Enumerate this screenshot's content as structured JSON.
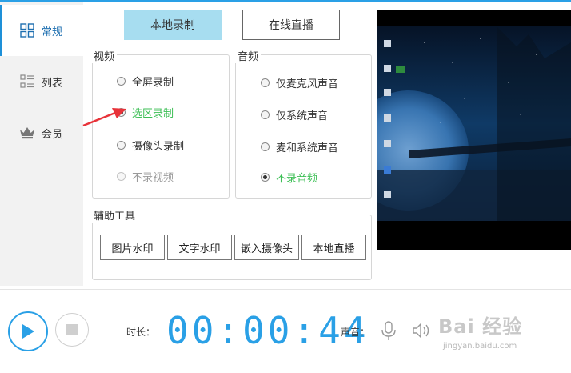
{
  "sidebar": {
    "items": [
      {
        "label": "常规",
        "icon": "grid-icon",
        "active": true
      },
      {
        "label": "列表",
        "icon": "list-icon",
        "active": false
      },
      {
        "label": "会员",
        "icon": "crown-icon",
        "active": false
      }
    ]
  },
  "mode_tabs": {
    "local": "本地录制",
    "live": "在线直播"
  },
  "video": {
    "title": "视频",
    "options": [
      "全屏录制",
      "选区录制",
      "摄像头录制",
      "不录视频"
    ],
    "selected": "选区录制"
  },
  "audio": {
    "title": "音频",
    "options": [
      "仅麦克风声音",
      "仅系统声音",
      "麦和系统声音",
      "不录音频"
    ],
    "selected": "不录音频"
  },
  "tools": {
    "title": "辅助工具",
    "buttons": [
      "图片水印",
      "文字水印",
      "嵌入摄像头",
      "本地直播"
    ]
  },
  "bottom": {
    "duration_label": "时长：",
    "timer": "00:00:44",
    "volume_label": "声音："
  },
  "watermark": {
    "main": "Bai 经验",
    "sub": "jingyan.baidu.com"
  },
  "colors": {
    "accent": "#2aa0e6",
    "selected_green": "#3cbf55",
    "annotation_arrow": "#e8333a"
  }
}
